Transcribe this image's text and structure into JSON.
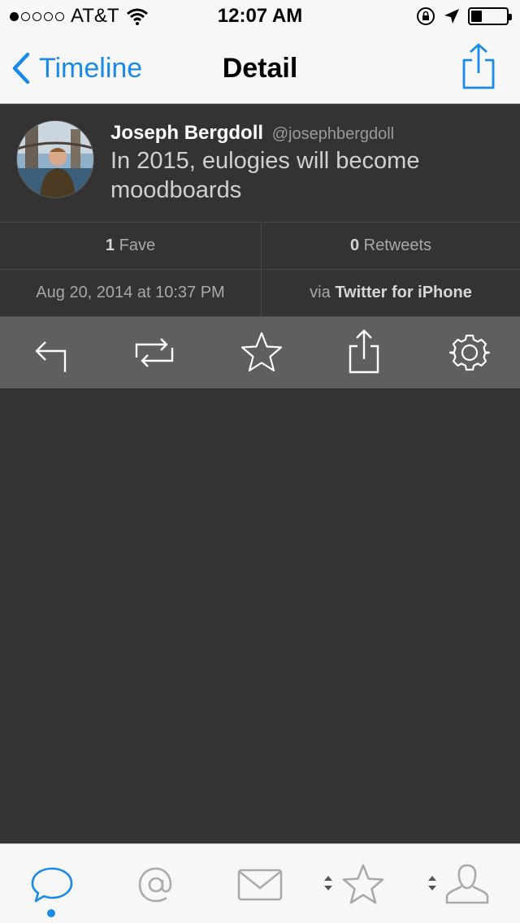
{
  "status_bar": {
    "carrier": "AT&T",
    "time": "12:07 AM",
    "battery_level": 0.3
  },
  "nav": {
    "back_label": "Timeline",
    "title": "Detail"
  },
  "tweet": {
    "name": "Joseph Bergdoll",
    "handle": "@josephbergdoll",
    "text": "In 2015, eulogies will become moodboards"
  },
  "stats": {
    "faves_count": "1",
    "faves_label": "Fave",
    "retweets_count": "0",
    "retweets_label": "Retweets"
  },
  "meta": {
    "date": "Aug 20, 2014 at 10:37 PM",
    "via_prefix": "via",
    "client": "Twitter for iPhone"
  },
  "actions": [
    "reply-icon",
    "retweet-icon",
    "star-icon",
    "share-icon",
    "gear-icon"
  ],
  "tabs": [
    "timeline-tab-icon",
    "mentions-tab-icon",
    "messages-tab-icon",
    "favorites-tab-icon",
    "profile-tab-icon"
  ],
  "colors": {
    "accent": "#1a8ae8",
    "background": "#333333",
    "action_bar": "#5f5f5f",
    "tab_inactive": "#aaaaaa"
  }
}
